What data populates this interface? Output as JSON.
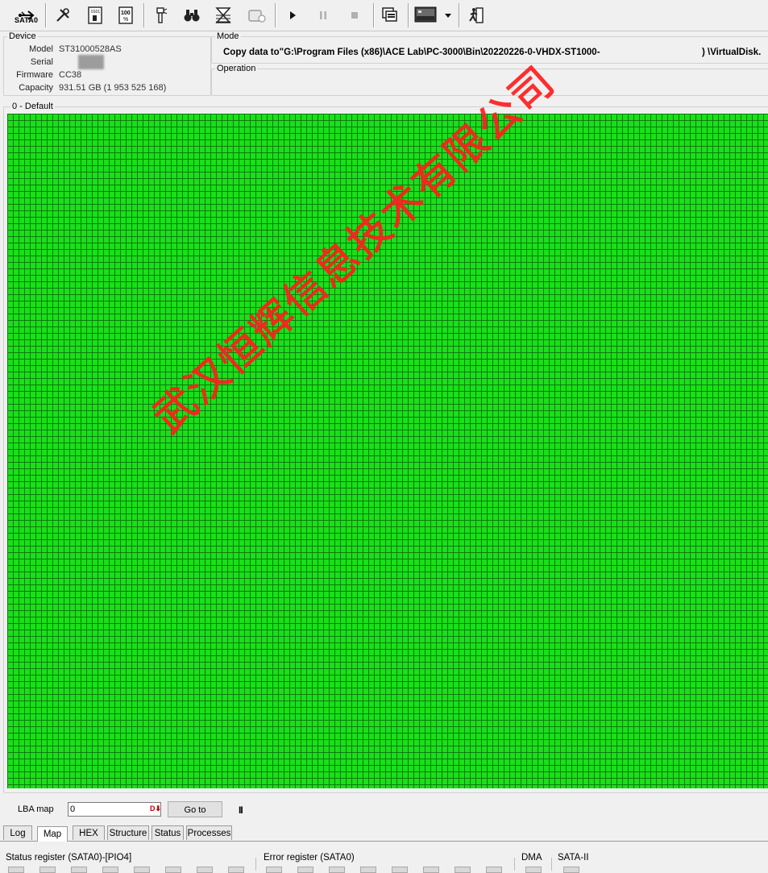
{
  "toolbar": {
    "port_label": "SATA0",
    "buttons": [
      "sata-port-icon",
      "tools-icon",
      "id-sheet-icon",
      "hundred-percent-icon",
      "flashlight-icon",
      "binoculars-icon",
      "hourglass-icon",
      "erase-icon",
      "play-icon",
      "pause-icon",
      "stop-icon",
      "copy-windows-icon",
      "image-monitor-icon",
      "dropdown-arrow-icon",
      "exit-icon"
    ]
  },
  "device": {
    "title": "Device",
    "rows": [
      {
        "label": "Model",
        "value": "ST31000528AS"
      },
      {
        "label": "Serial",
        "value": ""
      },
      {
        "label": "Firmware",
        "value": "CC38"
      },
      {
        "label": "Capacity",
        "value": "931.51 GB (1 953 525 168)"
      }
    ]
  },
  "mode": {
    "title": "Mode",
    "text": "Copy data to\"G:\\Program Files (x86)\\ACE Lab\\PC-3000\\Bin\\20220226-0-VHDX-ST1000-",
    "text_tail": ") \\VirtualDisk."
  },
  "operation": {
    "title": "Operation"
  },
  "map": {
    "title": "0 - Default",
    "cell_color": "#19e019",
    "watermark": "武汉恒辉信息技术有限公司"
  },
  "lba": {
    "label": "LBA map",
    "value": "0",
    "unit_icon": "D⬇",
    "goto_label": "Go to",
    "pause_label": "II"
  },
  "tabs": [
    {
      "label": "Log",
      "active": false
    },
    {
      "label": "Map",
      "active": true
    },
    {
      "label": "HEX",
      "active": false
    },
    {
      "label": "Structure",
      "active": false
    },
    {
      "label": "Status",
      "active": false
    },
    {
      "label": "Processes",
      "active": false
    }
  ],
  "status": {
    "status_register": "Status register (SATA0)-[PIO4]",
    "error_register": "Error register (SATA0)",
    "dma": "DMA",
    "sata": "SATA-II"
  }
}
